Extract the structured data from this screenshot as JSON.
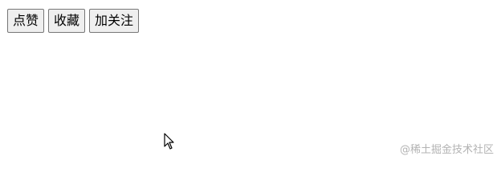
{
  "toolbar": {
    "buttons": [
      {
        "label": "点赞"
      },
      {
        "label": "收藏"
      },
      {
        "label": "加关注"
      }
    ]
  },
  "cursor": {
    "icon": "mouse-pointer-icon"
  },
  "watermark": {
    "text": "@稀土掘金技术社区"
  }
}
